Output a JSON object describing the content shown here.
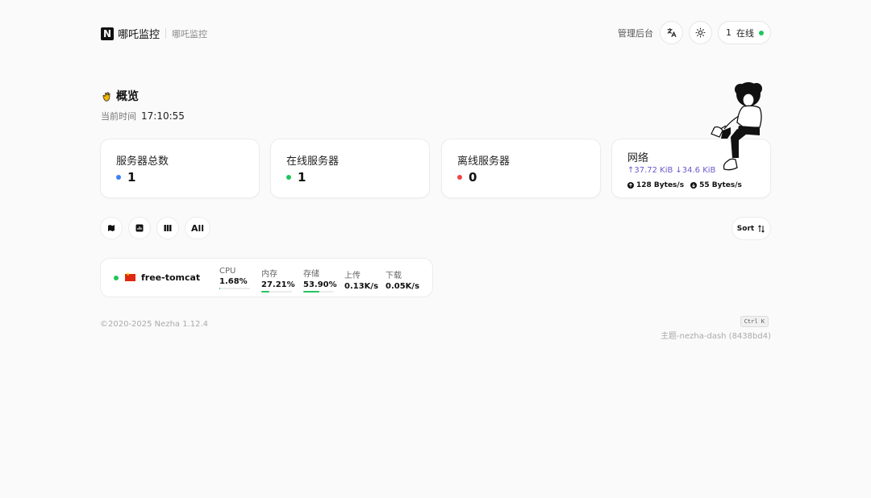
{
  "header": {
    "brand_logo": "N",
    "brand_name": "哪吒监控",
    "brand_sub": "哪吒监控",
    "admin_label": "管理后台",
    "online_count": "1",
    "online_label": "在线"
  },
  "overview": {
    "title": "概览",
    "time_label": "当前时间",
    "time_value": "17:10:55"
  },
  "stats": {
    "total": {
      "label": "服务器总数",
      "value": "1",
      "color": "#3b82f6"
    },
    "online": {
      "label": "在线服务器",
      "value": "1",
      "color": "#22c55e"
    },
    "offline": {
      "label": "离线服务器",
      "value": "0",
      "color": "#ef4444"
    },
    "network": {
      "label": "网络",
      "upload_total": "↑37.72 KiB",
      "download_total": "↓34.6 KiB",
      "upload_speed": "128 Bytes/s",
      "download_speed": "55 Bytes/s"
    }
  },
  "filters": {
    "all_label": "All",
    "sort_label": "Sort"
  },
  "servers": [
    {
      "name": "free-tomcat",
      "status_color": "#22c55e",
      "cpu_label": "CPU",
      "cpu_value": "1.68%",
      "cpu_pct": 1.68,
      "mem_label": "内存",
      "mem_value": "27.21%",
      "mem_pct": 27.21,
      "disk_label": "存储",
      "disk_value": "53.90%",
      "disk_pct": 53.9,
      "up_label": "上传",
      "up_value": "0.13K/s",
      "down_label": "下载",
      "down_value": "0.05K/s"
    }
  ],
  "footer": {
    "copyright": "©2020-2025 Nezha 1.12.4",
    "shortcut": "Ctrl K",
    "theme": "主题-nezha-dash (8438bd4)"
  }
}
